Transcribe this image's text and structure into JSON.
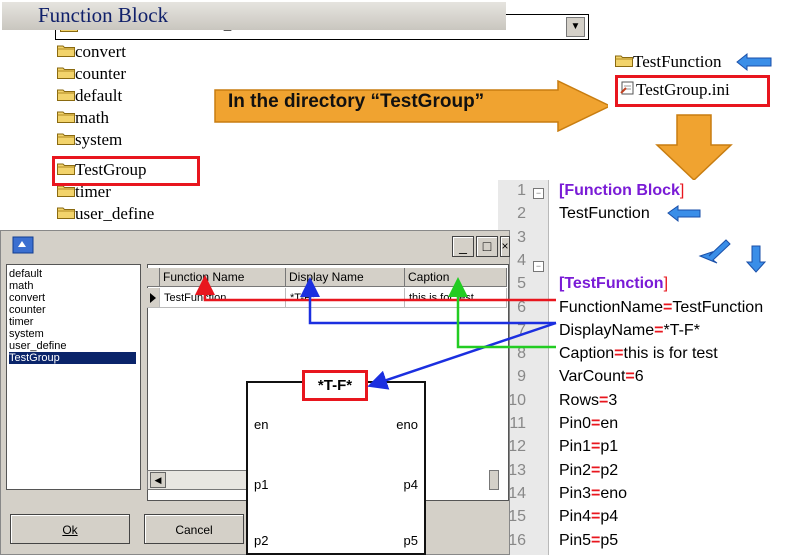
{
  "path_bar": {
    "path": "C:\\ICPDAS\\HMIWorks_Standard\\bin\\FunctionBlock",
    "dropdown_glyph": "▼"
  },
  "folders": [
    "convert",
    "counter",
    "default",
    "math",
    "system",
    "TestGroup",
    "timer",
    "user_define"
  ],
  "banner_text": "In the directory “TestGroup”",
  "right_panel": {
    "folder": "TestFunction",
    "ini_file": "TestGroup.ini"
  },
  "dialog": {
    "title": "Function Block",
    "title_buttons": [
      "_",
      "□",
      "×"
    ],
    "groups": [
      "default",
      "math",
      "convert",
      "counter",
      "timer",
      "system",
      "user_define",
      "TestGroup"
    ],
    "selected_group": "TestGroup",
    "grid_headers": [
      "Function Name",
      "Display Name",
      "Caption"
    ],
    "grid_row": {
      "function_name": "TestFunction",
      "display_name": "*T-F*",
      "caption": "this is for test"
    },
    "ok_label": "Ok",
    "cancel_label": "Cancel"
  },
  "block_preview": {
    "display_name": "*T-F*",
    "pins_left": [
      "en",
      "p1",
      "p2"
    ],
    "pins_right": [
      "eno",
      "p4",
      "p5"
    ]
  },
  "ini_editor": {
    "line_numbers": [
      "1",
      "2",
      "3",
      "4",
      "5",
      "6",
      "7",
      "8",
      "9",
      "10",
      "11",
      "12",
      "13",
      "14",
      "15",
      "16"
    ],
    "lines": [
      {
        "type": "section",
        "name": "Function Block"
      },
      {
        "type": "text",
        "text": "TestFunction"
      },
      {
        "type": "empty"
      },
      {
        "type": "empty"
      },
      {
        "type": "section",
        "name": "TestFunction"
      },
      {
        "type": "kv",
        "key": "FunctionName",
        "value": "TestFunction"
      },
      {
        "type": "kv",
        "key": "DisplayName",
        "value": "*T-F*"
      },
      {
        "type": "kv",
        "key": "Caption",
        "value": "this is for test"
      },
      {
        "type": "kv",
        "key": "VarCount",
        "value": "6"
      },
      {
        "type": "kv",
        "key": "Rows",
        "value": "3"
      },
      {
        "type": "kv",
        "key": "Pin0",
        "value": "en"
      },
      {
        "type": "kv",
        "key": "Pin1",
        "value": "p1"
      },
      {
        "type": "kv",
        "key": "Pin2",
        "value": "p2"
      },
      {
        "type": "kv",
        "key": "Pin3",
        "value": "eno"
      },
      {
        "type": "kv",
        "key": "Pin4",
        "value": "p4"
      },
      {
        "type": "kv",
        "key": "Pin5",
        "value": "p5"
      }
    ]
  },
  "colors": {
    "highlight_red": "#e8161e",
    "arrow_orange": "#f0a330",
    "arrow_blue": "#3a8ee8",
    "section_purple": "#7a1bd6",
    "link_green": "#22cc22",
    "link_blue": "#1b2fe0"
  }
}
